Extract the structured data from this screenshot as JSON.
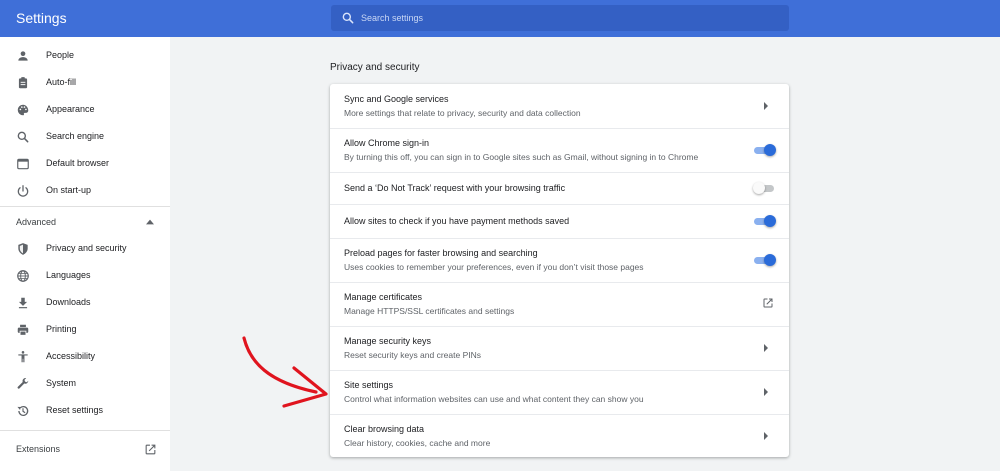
{
  "header": {
    "title": "Settings"
  },
  "search": {
    "placeholder": "Search settings"
  },
  "sidebar": {
    "items": [
      {
        "label": "People",
        "icon": "person-icon"
      },
      {
        "label": "Auto-fill",
        "icon": "clipboard-icon"
      },
      {
        "label": "Appearance",
        "icon": "palette-icon"
      },
      {
        "label": "Search engine",
        "icon": "search-icon"
      },
      {
        "label": "Default browser",
        "icon": "browser-window-icon"
      },
      {
        "label": "On start-up",
        "icon": "power-icon"
      }
    ],
    "advanced_label": "Advanced",
    "advanced_items": [
      {
        "label": "Privacy and security",
        "icon": "shield-icon"
      },
      {
        "label": "Languages",
        "icon": "globe-icon"
      },
      {
        "label": "Downloads",
        "icon": "download-icon"
      },
      {
        "label": "Printing",
        "icon": "printer-icon"
      },
      {
        "label": "Accessibility",
        "icon": "accessibility-icon"
      },
      {
        "label": "System",
        "icon": "wrench-icon"
      },
      {
        "label": "Reset settings",
        "icon": "reset-history-icon"
      }
    ],
    "extensions_label": "Extensions"
  },
  "main": {
    "section_title": "Privacy and security",
    "rows": [
      {
        "title": "Sync and Google services",
        "subtitle": "More settings that relate to privacy, security and data collection",
        "control": "arrow"
      },
      {
        "title": "Allow Chrome sign-in",
        "subtitle": "By turning this off, you can sign in to Google sites such as Gmail, without signing in to Chrome",
        "control": "toggle",
        "on": true
      },
      {
        "title": "Send a ‘Do Not Track’ request with your browsing traffic",
        "subtitle": "",
        "control": "toggle",
        "on": false
      },
      {
        "title": "Allow sites to check if you have payment methods saved",
        "subtitle": "",
        "control": "toggle",
        "on": true
      },
      {
        "title": "Preload pages for faster browsing and searching",
        "subtitle": "Uses cookies to remember your preferences, even if you don’t visit those pages",
        "control": "toggle",
        "on": true
      },
      {
        "title": "Manage certificates",
        "subtitle": "Manage HTTPS/SSL certificates and settings",
        "control": "external-link"
      },
      {
        "title": "Manage security keys",
        "subtitle": "Reset security keys and create PINs",
        "control": "arrow"
      },
      {
        "title": "Site settings",
        "subtitle": "Control what information websites can use and what content they can show you",
        "control": "arrow"
      },
      {
        "title": "Clear browsing data",
        "subtitle": "Clear history, cookies, cache and more",
        "control": "arrow"
      }
    ]
  },
  "colors": {
    "header": "#3f6fd8",
    "accent": "#2a6bd9",
    "annotation_arrow": "#e0141e"
  }
}
